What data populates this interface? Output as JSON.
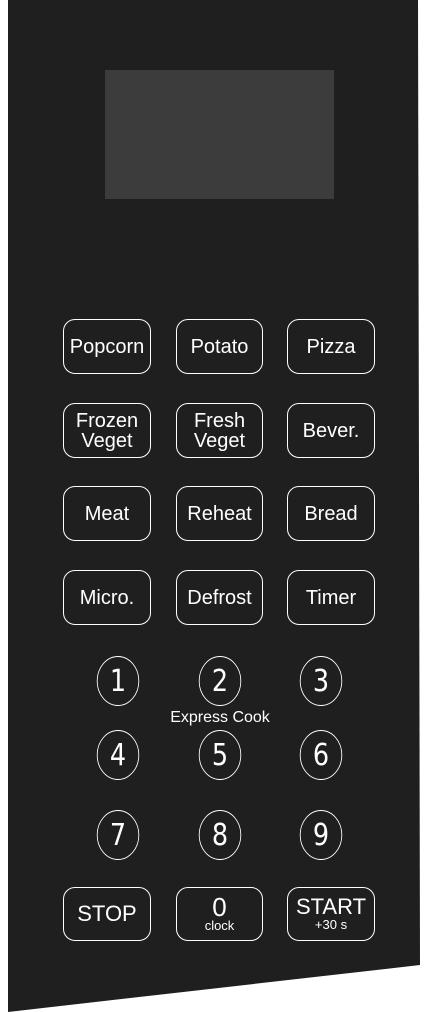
{
  "panel": {
    "background_color": "#1f1f1f",
    "display_color": "#3c3c3c",
    "key_border_color": "#ffffff"
  },
  "program_keys": {
    "popcorn": "Popcorn",
    "potato": "Potato",
    "pizza": "Pizza",
    "frozen_veget_line1": "Frozen",
    "frozen_veget_line2": "Veget",
    "fresh_veget_line1": "Fresh",
    "fresh_veget_line2": "Veget",
    "bever": "Bever.",
    "meat": "Meat",
    "reheat": "Reheat",
    "bread": "Bread",
    "micro": "Micro.",
    "defrost": "Defrost",
    "timer": "Timer"
  },
  "numpad": {
    "n1": "1",
    "n2": "2",
    "n3": "3",
    "n4": "4",
    "n5": "5",
    "n6": "6",
    "n7": "7",
    "n8": "8",
    "n9": "9",
    "express_label": "Express Cook"
  },
  "bottom_keys": {
    "stop": "STOP",
    "zero_main": "0",
    "zero_sub": "clock",
    "start_main": "START",
    "start_sub": "+30 s"
  }
}
